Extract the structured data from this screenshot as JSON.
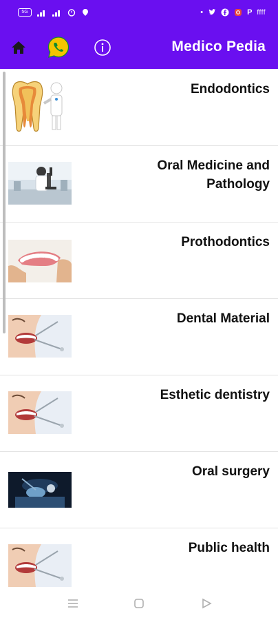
{
  "status_bar": {
    "left_badge": "5G",
    "right_letter": "P",
    "time": "ffff",
    "icons": [
      "signal-icon",
      "alarm-icon",
      "location-icon",
      "twitter-icon",
      "facebook-icon",
      "instagram-icon",
      "battery-icon"
    ]
  },
  "appbar": {
    "title": "Medico Pedia",
    "buttons": [
      "home",
      "whatsapp",
      "info"
    ]
  },
  "items": [
    {
      "label": "Endodontics",
      "thumb": "tooth-doctor"
    },
    {
      "label": "Oral Medicine and Pathology",
      "thumb": "lab-microscope"
    },
    {
      "label": "Prothodontics",
      "thumb": "denture"
    },
    {
      "label": "Dental Material",
      "thumb": "smile-dental-check"
    },
    {
      "label": "Esthetic dentistry",
      "thumb": "smile-dental-check"
    },
    {
      "label": "Oral surgery",
      "thumb": "surgery"
    },
    {
      "label": "Public health",
      "thumb": "smile-dental-check"
    }
  ],
  "colors": {
    "primary": "#6a0ff0",
    "whatsapp_yellow": "#f5c400"
  },
  "nav": [
    "menu-icon",
    "home-square-icon",
    "back-triangle-icon"
  ]
}
